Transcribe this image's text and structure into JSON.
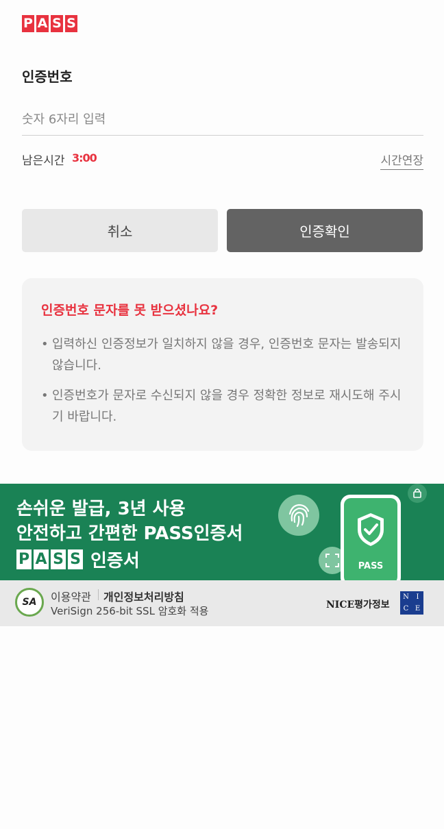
{
  "logo": {
    "letters": [
      "P",
      "A",
      "S",
      "S"
    ]
  },
  "form": {
    "section_label": "인증번호",
    "code_placeholder": "숫자 6자리 입력",
    "timer_label": "남은시간",
    "timer_value": "3:00",
    "extend_label": "시간연장"
  },
  "buttons": {
    "cancel_label": "취소",
    "confirm_label": "인증확인"
  },
  "notice": {
    "title": "인증번호 문자를 못 받으셨나요?",
    "items": [
      "입력하신 인증정보가 일치하지 않을 경우, 인증번호 문자는 발송되지 않습니다.",
      "인증번호가 문자로 수신되지 않을 경우 정확한 정보로 재시도해 주시기 바랍니다."
    ]
  },
  "banner": {
    "line1": "손쉬운 발급, 3년 사용",
    "line2": "안전하고 간편한 PASS인증서",
    "brand_letters": [
      "P",
      "A",
      "S",
      "S"
    ],
    "cert_label": "인증서",
    "phone_label": "PASS"
  },
  "footer": {
    "badge": "SA",
    "terms_label": "이용약관",
    "privacy_label": "개인정보처리방침",
    "ssl_text": "VeriSign 256-bit SSL 암호화 적용",
    "company_name": "NICE평가정보",
    "company_logo_letters": [
      "N",
      "I",
      "C",
      "E"
    ]
  },
  "colors": {
    "brand_red": "#e8323f",
    "banner_green": "#1a8255",
    "confirm_gray": "#636363"
  }
}
